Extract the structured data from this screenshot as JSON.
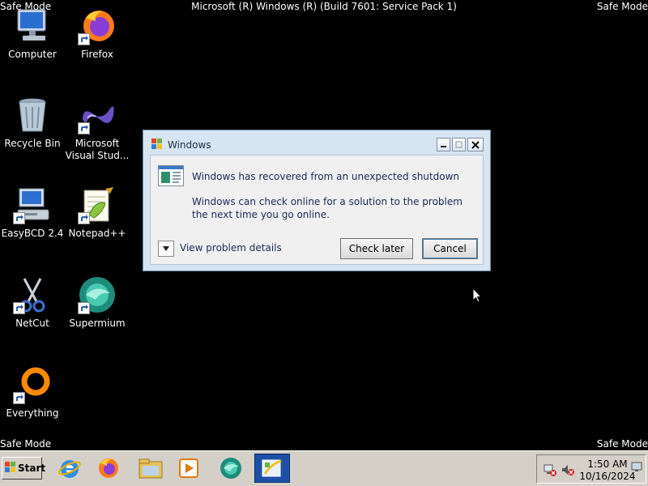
{
  "desktop": {
    "safe_mode_label": "Safe Mode",
    "os_banner": "Microsoft (R) Windows (R) (Build 7601: Service Pack 1)",
    "icons": [
      {
        "label": "Computer",
        "icon": "computer-icon"
      },
      {
        "label": "Firefox",
        "icon": "firefox-icon"
      },
      {
        "label": "Recycle Bin",
        "icon": "recycle-bin-icon"
      },
      {
        "label": "Microsoft Visual Stud...",
        "icon": "visual-studio-icon"
      },
      {
        "label": "EasyBCD 2.4",
        "icon": "easybcd-icon"
      },
      {
        "label": "Notepad++",
        "icon": "notepadpp-icon"
      },
      {
        "label": "NetCut",
        "icon": "scissors-icon"
      },
      {
        "label": "Supermium",
        "icon": "supermium-icon"
      },
      {
        "label": "Everything",
        "icon": "everything-icon"
      }
    ]
  },
  "dialog": {
    "title": "Windows",
    "heading": "Windows has recovered from an unexpected shutdown",
    "detail": "Windows can check online for a solution to the problem the next time you go online.",
    "details_toggle_label": "View problem details",
    "check_later_label": "Check later",
    "cancel_label": "Cancel"
  },
  "taskbar": {
    "start_label": "Start",
    "pinned": [
      "internet-explorer-icon",
      "firefox-icon",
      "file-explorer-icon",
      "media-player-icon",
      "supermium-icon",
      "problem-reports-icon"
    ],
    "clock_time": "1:50 AM",
    "clock_date": "10/16/2024"
  },
  "colors": {
    "desktop_bg": "#000000",
    "dialog_frame": "#d7e4f2",
    "taskbar_bg": "#d4d0c8",
    "active_task": "#1e4fa8"
  }
}
